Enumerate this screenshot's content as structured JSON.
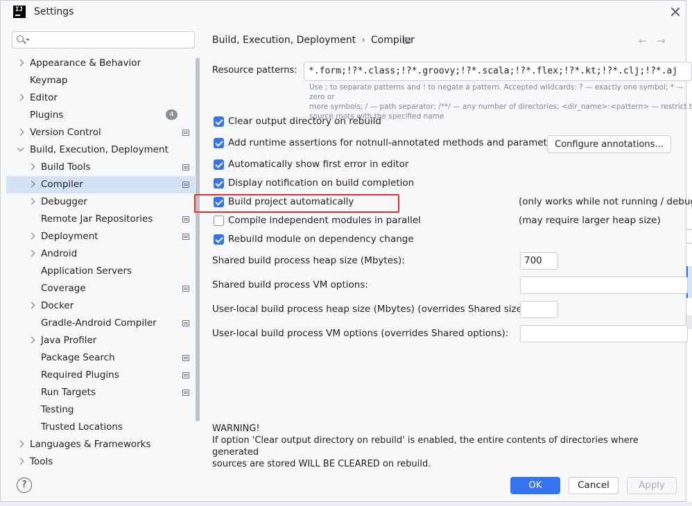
{
  "window": {
    "title": "Settings",
    "logo_text": "IJ"
  },
  "search": {
    "placeholder": "",
    "value": ""
  },
  "sidebar": {
    "items": [
      {
        "label": "Appearance & Behavior",
        "level": 0,
        "chevron": "right",
        "project_icon": false
      },
      {
        "label": "Keymap",
        "level": 0,
        "chevron": "none",
        "project_icon": false
      },
      {
        "label": "Editor",
        "level": 0,
        "chevron": "right",
        "project_icon": false
      },
      {
        "label": "Plugins",
        "level": 0,
        "chevron": "none",
        "project_icon": false,
        "badge": "4"
      },
      {
        "label": "Version Control",
        "level": 0,
        "chevron": "right",
        "project_icon": true
      },
      {
        "label": "Build, Execution, Deployment",
        "level": 0,
        "chevron": "down",
        "project_icon": false
      },
      {
        "label": "Build Tools",
        "level": 1,
        "chevron": "right",
        "project_icon": true
      },
      {
        "label": "Compiler",
        "level": 1,
        "chevron": "right",
        "project_icon": true,
        "selected": true
      },
      {
        "label": "Debugger",
        "level": 1,
        "chevron": "right",
        "project_icon": false
      },
      {
        "label": "Remote Jar Repositories",
        "level": 1,
        "chevron": "none",
        "project_icon": true
      },
      {
        "label": "Deployment",
        "level": 1,
        "chevron": "right",
        "project_icon": true
      },
      {
        "label": "Android",
        "level": 1,
        "chevron": "right",
        "project_icon": false
      },
      {
        "label": "Application Servers",
        "level": 1,
        "chevron": "none",
        "project_icon": false
      },
      {
        "label": "Coverage",
        "level": 1,
        "chevron": "none",
        "project_icon": true
      },
      {
        "label": "Docker",
        "level": 1,
        "chevron": "right",
        "project_icon": false
      },
      {
        "label": "Gradle-Android Compiler",
        "level": 1,
        "chevron": "none",
        "project_icon": true
      },
      {
        "label": "Java Profiler",
        "level": 1,
        "chevron": "right",
        "project_icon": false
      },
      {
        "label": "Package Search",
        "level": 1,
        "chevron": "none",
        "project_icon": true
      },
      {
        "label": "Required Plugins",
        "level": 1,
        "chevron": "none",
        "project_icon": true
      },
      {
        "label": "Run Targets",
        "level": 1,
        "chevron": "none",
        "project_icon": true
      },
      {
        "label": "Testing",
        "level": 1,
        "chevron": "none",
        "project_icon": false
      },
      {
        "label": "Trusted Locations",
        "level": 1,
        "chevron": "none",
        "project_icon": false
      },
      {
        "label": "Languages & Frameworks",
        "level": 0,
        "chevron": "right",
        "project_icon": false
      },
      {
        "label": "Tools",
        "level": 0,
        "chevron": "right",
        "project_icon": false
      }
    ]
  },
  "breadcrumb": {
    "parent": "Build, Execution, Deployment",
    "separator": "›",
    "current": "Compiler",
    "back": "←",
    "forward": "→"
  },
  "resource": {
    "label": "Resource patterns:",
    "value": "*.form;!?*.class;!?*.groovy;!?*.scala;!?*.flex;!?*.kt;!?*.clj;!?*.aj",
    "hint_1": "Use ; to separate patterns and ! to negate a pattern. Accepted wildcards: ? — exactly one symbol; * — zero or",
    "hint_2": "more symbols; / — path separator; /**/ — any number of directories; <dir_name>:<pattern> — restrict to",
    "hint_3": "source roots with the specified name"
  },
  "options": [
    {
      "label": "Clear output directory on rebuild",
      "checked": true
    },
    {
      "label": "Add runtime assertions for notnull-annotated methods and parameters",
      "checked": true
    },
    {
      "label": "Automatically show first error in editor",
      "checked": true
    },
    {
      "label": "Display notification on build completion",
      "checked": true
    },
    {
      "label": "Build project automatically",
      "checked": true,
      "note": "(only works while not running / debugging)"
    },
    {
      "label": "Compile independent modules in parallel",
      "checked": false,
      "note": "(may require larger heap size)"
    },
    {
      "label": "Rebuild module on dependency change",
      "checked": true
    }
  ],
  "configure_annotations": "Configure annotations...",
  "fields": [
    {
      "label": "Shared build process heap size (Mbytes):",
      "value": "700"
    },
    {
      "label": "Shared build process VM options:",
      "value": ""
    },
    {
      "label": "User-local build process heap size (Mbytes) (overrides Shared size):",
      "value": ""
    },
    {
      "label": "User-local build process VM options (overrides Shared options):",
      "value": ""
    }
  ],
  "warning": {
    "title": "WARNING!",
    "line1": "If option 'Clear output directory on rebuild' is enabled, the entire contents of directories where generated",
    "line2": "sources are stored WILL BE CLEARED on rebuild."
  },
  "footer": {
    "help": "?",
    "ok": "OK",
    "cancel": "Cancel",
    "apply": "Apply"
  },
  "colors": {
    "accent": "#3574f0",
    "selection": "#d5e1f5",
    "highlight_box": "#e0312b",
    "background": "#f7f8fa"
  }
}
